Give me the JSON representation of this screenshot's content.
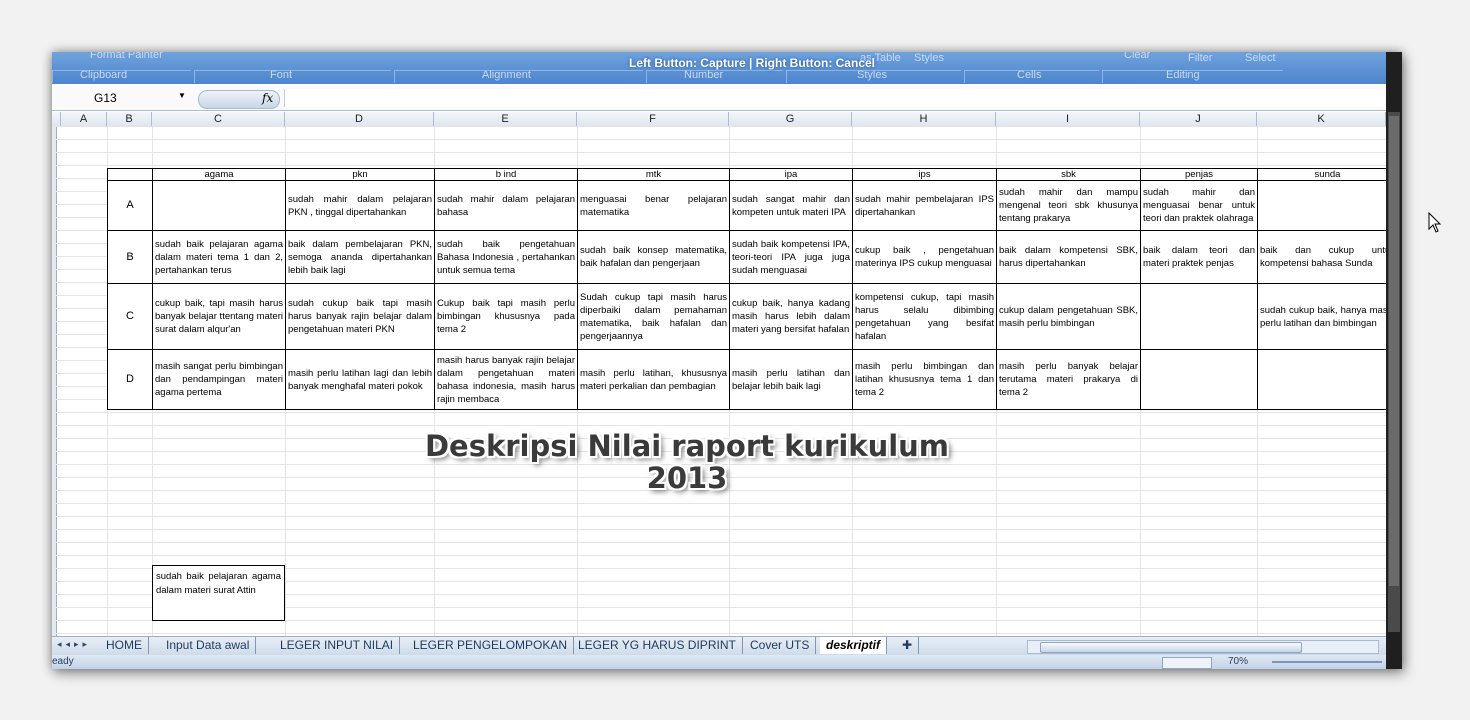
{
  "ribbon": {
    "capture_text": "Left Button: Capture | Right Button: Cancel",
    "groups": [
      "Clipboard",
      "Font",
      "Alignment",
      "Number",
      "Styles",
      "Cells",
      "Editing"
    ],
    "format_painter": "Format Painter",
    "as_table": "as Table",
    "styles_btn": "Styles",
    "clear": "Clear",
    "filter": "Filter",
    "select": "Select"
  },
  "formula_bar": {
    "name_box": "G13",
    "fx": "fx"
  },
  "columns": [
    "A",
    "B",
    "C",
    "D",
    "E",
    "F",
    "G",
    "H",
    "I",
    "J",
    "K"
  ],
  "table": {
    "headers": [
      "",
      "agama",
      "pkn",
      "b ind",
      "mtk",
      "ipa",
      "ips",
      "sbk",
      "penjas",
      "sunda"
    ],
    "rows": [
      {
        "grade": "A",
        "cells": [
          "",
          "sudah mahir dalam pelajaran PKN , tinggal dipertahankan",
          "sudah mahir dalam pelajaran bahasa",
          "menguasai benar pelajaran matematika",
          "sudah sangat mahir dan kompeten untuk materi IPA",
          "sudah mahir pembelajaran IPS dipertahankan",
          "sudah mahir dan mampu mengenal teori sbk khusunya tentang prakarya",
          "sudah mahir dan menguasai benar untuk teori dan praktek olahraga",
          ""
        ]
      },
      {
        "grade": "B",
        "cells": [
          "sudah baik pelajaran agama dalam materi tema 1 dan 2, pertahankan terus",
          "baik dalam pembelajaran PKN, semoga ananda dipertahankan lebih baik lagi",
          "sudah baik pengetahuan Bahasa Indonesia , pertahankan untuk semua tema",
          "sudah baik konsep matematika, baik hafalan dan pengerjaan",
          "sudah baik kompetensi IPA, teori-teori IPA juga juga sudah menguasai",
          "cukup baik , pengetahuan materinya IPS cukup menguasai",
          "baik dalam kompetensi SBK, harus dipertahankan",
          "baik dalam teori dan materi praktek penjas",
          "baik dan cukup untuk kompetensi bahasa Sunda"
        ]
      },
      {
        "grade": "C",
        "cells": [
          "cukup baik, tapi masih harus banyak belajar ttentang materi surat dalam alqur'an",
          "sudah cukup baik tapi masih harus banyak rajin belajar dalam pengetahuan materi PKN",
          "Cukup baik tapi masih perlu bimbingan khususnya pada tema 2",
          "Sudah cukup tapi masih harus diperbaiki dalam pemahaman matematika, baik hafalan dan pengerjaannya",
          "cukup baik, hanya kadang masih harus lebih dalam materi yang bersifat hafalan",
          "kompetensi cukup, tapi masih harus selalu dibimbing pengetahuan yang besifat hafalan",
          "cukup dalam pengetahuan SBK, masih perlu bimbingan",
          "",
          "sudah cukup baik, hanya masih perlu latihan dan bimbingan"
        ]
      },
      {
        "grade": "D",
        "cells": [
          "masih sangat perlu bimbingan dan pendampingan materi agama pertema",
          "masih perlu latihan lagi dan lebih banyak menghafal materi pokok",
          "masih harus banyak rajin belajar dalam pengetahuan materi bahasa indonesia, masih harus rajin membaca",
          "masih perlu latihan, khususnya materi perkalian dan pembagian",
          "masih perlu latihan dan belajar lebih baik lagi",
          "masih perlu bimbingan dan latihan khususnya tema 1 dan tema 2",
          "masih perlu banyak belajar terutama materi prakarya di tema 2",
          "",
          ""
        ]
      }
    ]
  },
  "small_box_text": "sudah baik pelajaran agama dalam materi surat Attin",
  "overlay_title_line1": "Deskripsi Nilai raport kurikulum",
  "overlay_title_line2": "2013",
  "sheet_tabs": [
    "HOME",
    "Input Data awal",
    "LEGER INPUT NILAI",
    "LEGER PENGELOMPOKAN",
    "LEGER YG HARUS DIPRINT",
    "Cover UTS",
    "deskriptif"
  ],
  "active_tab": "deskriptif",
  "status": {
    "ready": "eady",
    "zoom": "70%"
  }
}
